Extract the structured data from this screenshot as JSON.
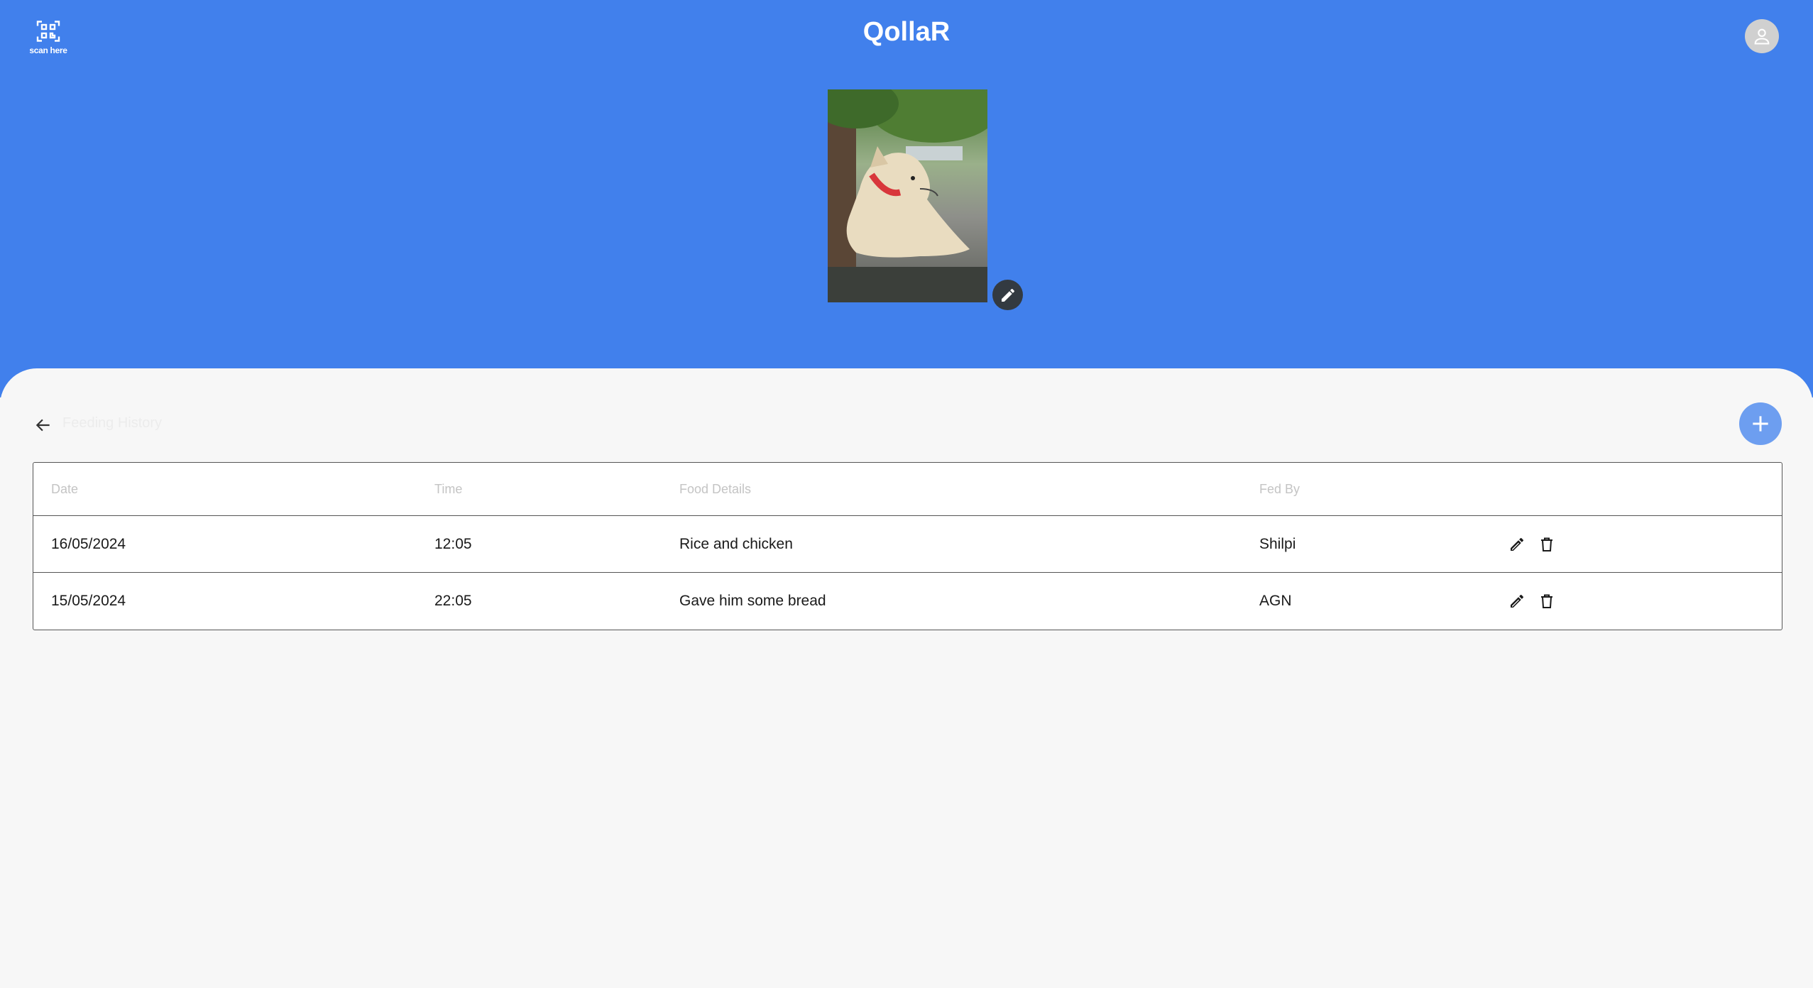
{
  "app": {
    "title": "QollaR"
  },
  "scan": {
    "label": "scan here"
  },
  "feeding": {
    "title": "Feeding History",
    "columns": {
      "date": "Date",
      "time": "Time",
      "food": "Food Details",
      "fed_by": "Fed By"
    },
    "rows": [
      {
        "date": "16/05/2024",
        "time": "12:05",
        "food": "Rice and chicken",
        "fed_by": "Shilpi"
      },
      {
        "date": "15/05/2024",
        "time": "22:05",
        "food": "Gave him some bread",
        "fed_by": "AGN"
      }
    ]
  },
  "icons": {
    "scan": "qr-scan-icon",
    "profile": "user-icon",
    "photo_edit": "pencil-icon",
    "back": "arrow-left-icon",
    "add": "plus-icon",
    "row_edit": "pencil-icon",
    "row_delete": "trash-icon"
  },
  "colors": {
    "header": "#4180ec",
    "add_button": "#6d9ef0",
    "background": "#f7f7f7"
  }
}
